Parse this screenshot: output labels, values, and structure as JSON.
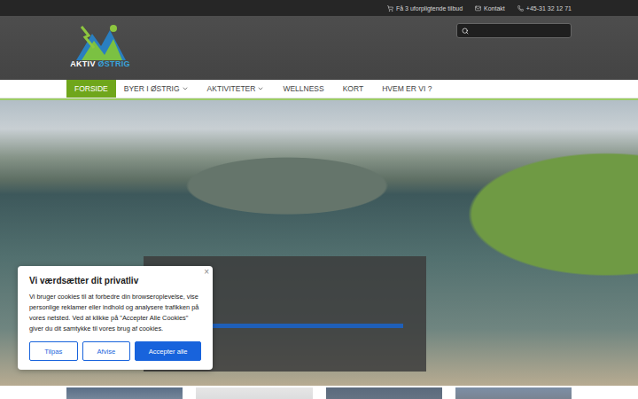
{
  "topbar": {
    "links": [
      {
        "label": "Få 3 uforpligtende tilbud"
      },
      {
        "label": "Kontakt"
      },
      {
        "label": "+45-31 32 12 71"
      }
    ]
  },
  "logo": {
    "first": "AKTIV",
    "second": "ØSTRIG"
  },
  "search": {
    "placeholder": ""
  },
  "nav": [
    {
      "label": "FORSIDE",
      "selected": true,
      "dropdown": false
    },
    {
      "label": "BYER I ØSTRIG",
      "selected": false,
      "dropdown": true
    },
    {
      "label": "AKTIVITETER",
      "selected": false,
      "dropdown": true
    },
    {
      "label": "WELLNESS",
      "selected": false,
      "dropdown": false
    },
    {
      "label": "KORT",
      "selected": false,
      "dropdown": false
    },
    {
      "label": "HVEM ER VI ?",
      "selected": false,
      "dropdown": false
    }
  ],
  "cookie": {
    "title": "Vi værdsætter dit privatliv",
    "text": "Vi bruger cookies til at forbedre din browseroplevelse, vise personlige reklamer eller indhold og analysere trafikken på vores netsted. Ved at klikke på \"Accepter Alle Cookies\" giver du dit samtykke til vores brug af cookies.",
    "close": "×",
    "buttons": [
      {
        "label": "Tilpas",
        "kind": "outline"
      },
      {
        "label": "Afvise",
        "kind": "outline"
      },
      {
        "label": "Accepter alle",
        "kind": "primary"
      }
    ]
  }
}
